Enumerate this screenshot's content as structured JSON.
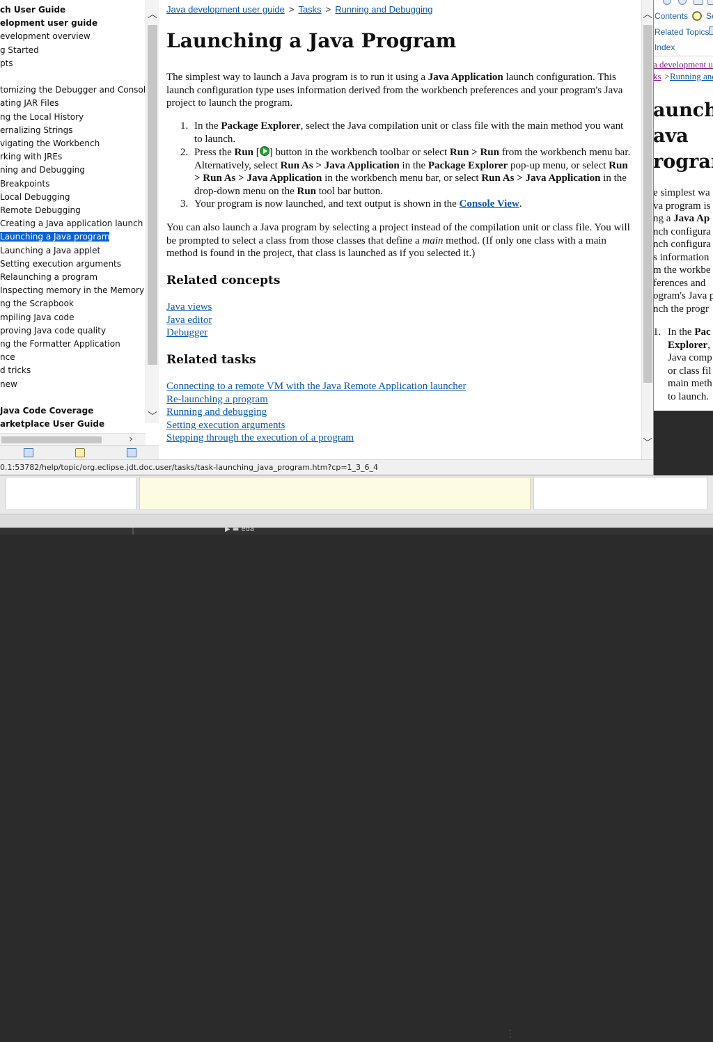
{
  "toc": {
    "items": [
      {
        "label": "ch User Guide",
        "bold": true
      },
      {
        "label": "elopment user guide",
        "bold": true
      },
      {
        "label": "evelopment overview",
        "bold": false
      },
      {
        "label": "g Started",
        "bold": false
      },
      {
        "label": "pts",
        "bold": false
      },
      {
        "label": "",
        "bold": false
      },
      {
        "label": "tomizing the Debugger and Console",
        "bold": false
      },
      {
        "label": "ating JAR Files",
        "bold": false
      },
      {
        "label": "ng the Local History",
        "bold": false
      },
      {
        "label": "ernalizing Strings",
        "bold": false
      },
      {
        "label": "vigating the Workbench",
        "bold": false
      },
      {
        "label": "rking with JREs",
        "bold": false
      },
      {
        "label": "ning and Debugging",
        "bold": false
      },
      {
        "label": "Breakpoints",
        "bold": false
      },
      {
        "label": "Local Debugging",
        "bold": false
      },
      {
        "label": "Remote Debugging",
        "bold": false
      },
      {
        "label": "Creating a Java application launch confi",
        "bold": false
      },
      {
        "label": "Launching a Java program",
        "bold": false,
        "selected": true
      },
      {
        "label": "Launching a Java applet",
        "bold": false
      },
      {
        "label": "Setting execution arguments",
        "bold": false
      },
      {
        "label": "Relaunching a program",
        "bold": false
      },
      {
        "label": "Inspecting memory in the Memory view",
        "bold": false
      },
      {
        "label": "ng the Scrapbook",
        "bold": false
      },
      {
        "label": "mpiling Java code",
        "bold": false
      },
      {
        "label": "proving Java code quality",
        "bold": false
      },
      {
        "label": "ng the Formatter Application",
        "bold": false
      },
      {
        "label": "nce",
        "bold": false
      },
      {
        "label": "d tricks",
        "bold": false
      },
      {
        "label": " new",
        "bold": false
      },
      {
        "label": "",
        "bold": false
      },
      {
        "label": "Java Code Coverage",
        "bold": true
      },
      {
        "label": "arketplace User Guide",
        "bold": true
      }
    ]
  },
  "content": {
    "breadcrumb": {
      "items": [
        "Java development user guide",
        "Tasks",
        "Running and Debugging"
      ],
      "separator": ">"
    },
    "title": "Launching a Java Program",
    "intro": {
      "t1": "The simplest way to launch a Java program is to run it using a ",
      "b1": "Java Application",
      "t2": " launch configuration. This launch configuration type uses information derived from the workbench preferences and your program's Java project to launch the program."
    },
    "steps": [
      {
        "num": "1.",
        "t1": "In the ",
        "b1": "Package Explorer",
        "t2": ", select the Java compilation unit or class file with the main method you want to launch."
      },
      {
        "num": "2.",
        "t1": "Press the ",
        "b1": "Run",
        "t2": " [",
        "t3": "] button in the workbench toolbar or select ",
        "b2": "Run > Run",
        "t4": " from the workbench menu bar. Alternatively, select ",
        "b3": "Run As > Java Application",
        "t5": " in the ",
        "b4": "Package Explorer",
        "t6": " pop-up menu, or select ",
        "b5": "Run > Run As > Java Application",
        "t7": " in the workbench menu bar, or select ",
        "b6": "Run As > Java Application",
        "t8": " in the drop-down menu on the ",
        "b7": "Run",
        "t9": " tool bar button."
      },
      {
        "num": "3.",
        "t1": "Your program is now launched, and text output is shown in the ",
        "link": "Console View",
        "t2": "."
      }
    ],
    "para2": {
      "t1": "You can also launch a Java program by selecting a project instead of the compilation unit or class file. You will be prompted to select a class from those classes that define a ",
      "i1": "main",
      "t2": " method.  (If only one class with a main method is found in the project, that class is launched as if you selected it.)"
    },
    "related_concepts": {
      "heading": "Related concepts",
      "links": [
        "Java views",
        "Java editor",
        "Debugger"
      ]
    },
    "related_tasks": {
      "heading": "Related tasks",
      "links": [
        "Connecting to a remote VM with the Java Remote Application launcher",
        "Re-launching a program",
        "Running and debugging",
        "Setting execution arguments",
        "Stepping through the execution of a program"
      ]
    }
  },
  "status_bar": {
    "url": "0.1:53782/help/topic/org.eclipse.jdt.doc.user/tasks/task-launching_java_program.htm?cp=1_3_6_4"
  },
  "back_window": {
    "nav": [
      "Contents",
      "Related Topics",
      "Index"
    ],
    "nav_partial": "Se",
    "crumb1": "a development u",
    "crumb2_prefix": "ks",
    "crumb2_sep": " > ",
    "crumb2": "Running and",
    "title_lines": [
      "aunch",
      "ava",
      "rogram"
    ],
    "para_lines": [
      "e simplest wa",
      "va program is",
      "ng a Java Ap",
      "nch configura",
      "nch configura",
      "s information",
      "m the workbe",
      "ferences and",
      "ogram's Java p",
      "nch the progr"
    ],
    "para_bold": "Java Ap",
    "list_num": "1.",
    "list_lines": [
      "In the Pac",
      "Explorer,",
      "Java comp",
      "or class fil",
      "main meth",
      "to launch."
    ],
    "list_bold_1": "Pac",
    "list_bold_2": "Explorer"
  },
  "background": {
    "taskbar_label": "eda"
  }
}
